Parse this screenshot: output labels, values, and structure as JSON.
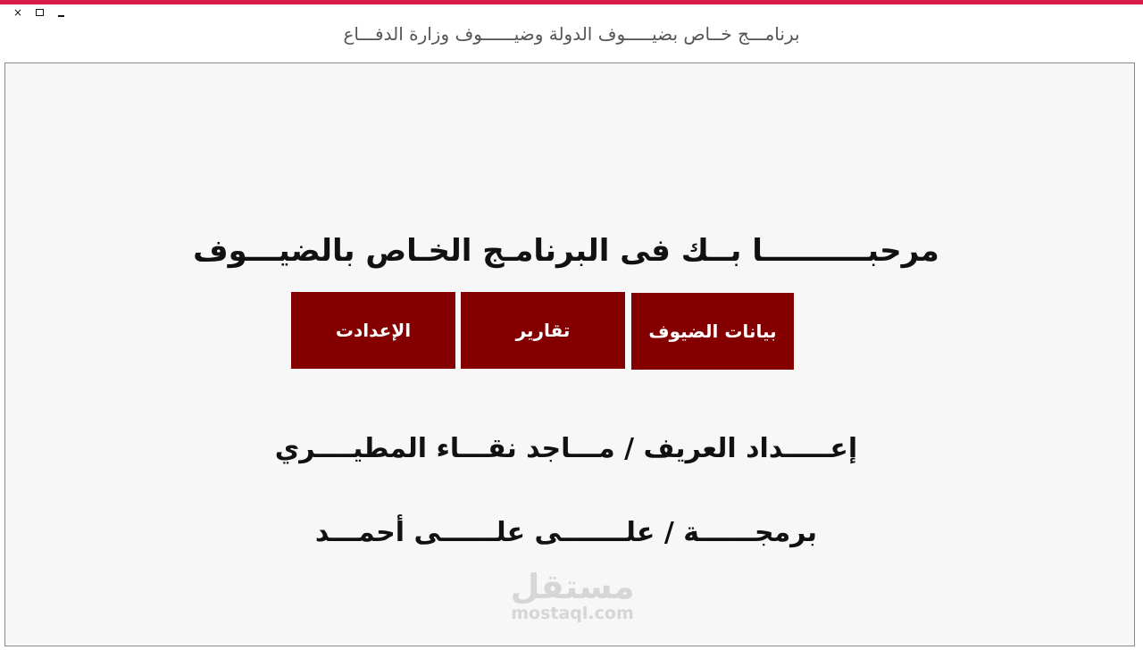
{
  "window": {
    "title": "برنامـــج  خــاص بضيـــــوف الدولة وضيــــــوف وزارة الدفـــاع",
    "controls": {
      "close": "×"
    }
  },
  "main": {
    "welcome_text": "مرحبــــــــــا بــك فى البرنامـج الخـاص بالضيـــوف",
    "buttons": {
      "guests": "بيانات الضيوف",
      "reports": "تقارير",
      "settings": "الإعدادت"
    },
    "credits": {
      "prepared_by": "إعـــــداد العريف /   مـــاجد نقـــاء المطيــــري",
      "programmed_by": "برمجــــــة / علـــــــى  علــــــى أحمـــد"
    }
  },
  "watermark": {
    "arabic": "مستقل",
    "latin": "mostaql.com"
  },
  "colors": {
    "accent_bar": "#d81b47",
    "button_bg": "#840000",
    "button_text": "#ffffff"
  }
}
